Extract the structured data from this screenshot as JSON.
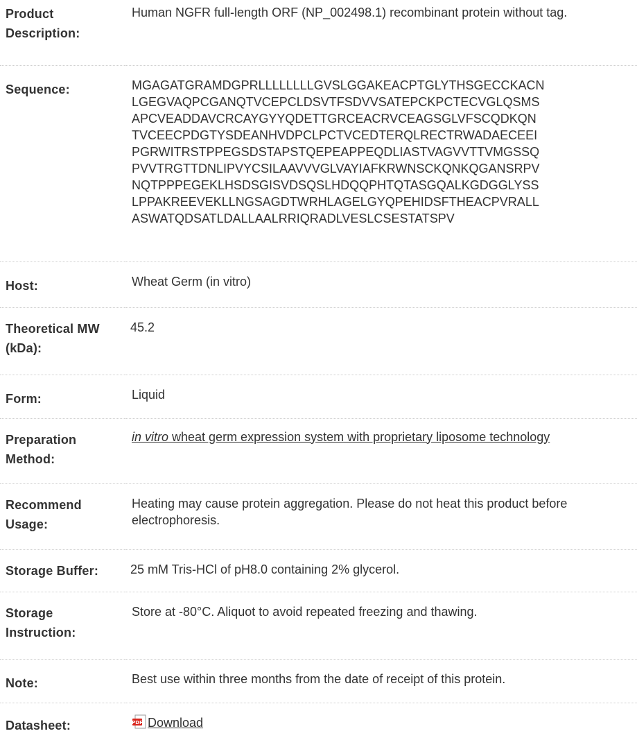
{
  "rows": {
    "description": {
      "label": "Product Description:",
      "value": "Human NGFR full-length ORF (NP_002498.1) recombinant protein without tag."
    },
    "sequence": {
      "label": "Sequence:",
      "lines": [
        "MGAGATGRAMDGPRLLLLLLLLGVSLGGAKEACPTGLYTHSGECCKACN",
        "LGEGVAQPCGANQTVCEPCLDSVTFSDVVSATEPCKPCTECVGLQSMS",
        "APCVEADDAVCRCAYGYYQDETTGRCEACRVCEAGSGLVFSCQDKQN",
        "TVCEECPDGTYSDEANHVDPCLPCTVCEDTERQLRECTRWADAECEEI",
        "PGRWITRSTPPEGSDSTAPSTQEPEAPPEQDLIASTVAGVVTTVMGSSQ",
        "PVVTRGTTDNLIPVYCSILAAVVVGLVAYIAFKRWNSCKQNKQGANSRPV",
        "NQTPPPEGEKLHSDSGISVDSQSLHDQQPHTQTASGQALKGDGGLYSS",
        "LPPAKREEVEKLLNGSAGDTWRHLAGELGYQPEHIDSFTHEACPVRALL",
        "ASWATQDSATLDALLAALRRIQRADLVESLCSESTATSPV"
      ]
    },
    "host": {
      "label": "Host:",
      "value": "Wheat Germ (in vitro)"
    },
    "mw": {
      "label": "Theoretical MW (kDa):",
      "value": "45.2"
    },
    "form": {
      "label": "Form:",
      "value": "Liquid"
    },
    "preparation": {
      "label": "Preparation Method:",
      "italic": "in vitro",
      "value": " wheat germ expression system with proprietary liposome technology"
    },
    "usage": {
      "label": "Recommend Usage:",
      "value": "Heating may cause protein aggregation. Please do not heat this product before electrophoresis."
    },
    "buffer": {
      "label": "Storage Buffer:",
      "value": "25 mM Tris-HCl of pH8.0 containing 2% glycerol."
    },
    "storage": {
      "label": "Storage Instruction:",
      "value": "Store at -80°C. Aliquot to avoid repeated freezing and thawing."
    },
    "note": {
      "label": "Note:",
      "value": "Best use within three months from the date of receipt of this protein."
    },
    "datasheet": {
      "label": "Datasheet:",
      "link": "Download",
      "icon": "pdf-icon"
    }
  },
  "colors": {
    "text": "#333333",
    "divider": "#cfcfcf",
    "pdf_red": "#d9251c"
  }
}
